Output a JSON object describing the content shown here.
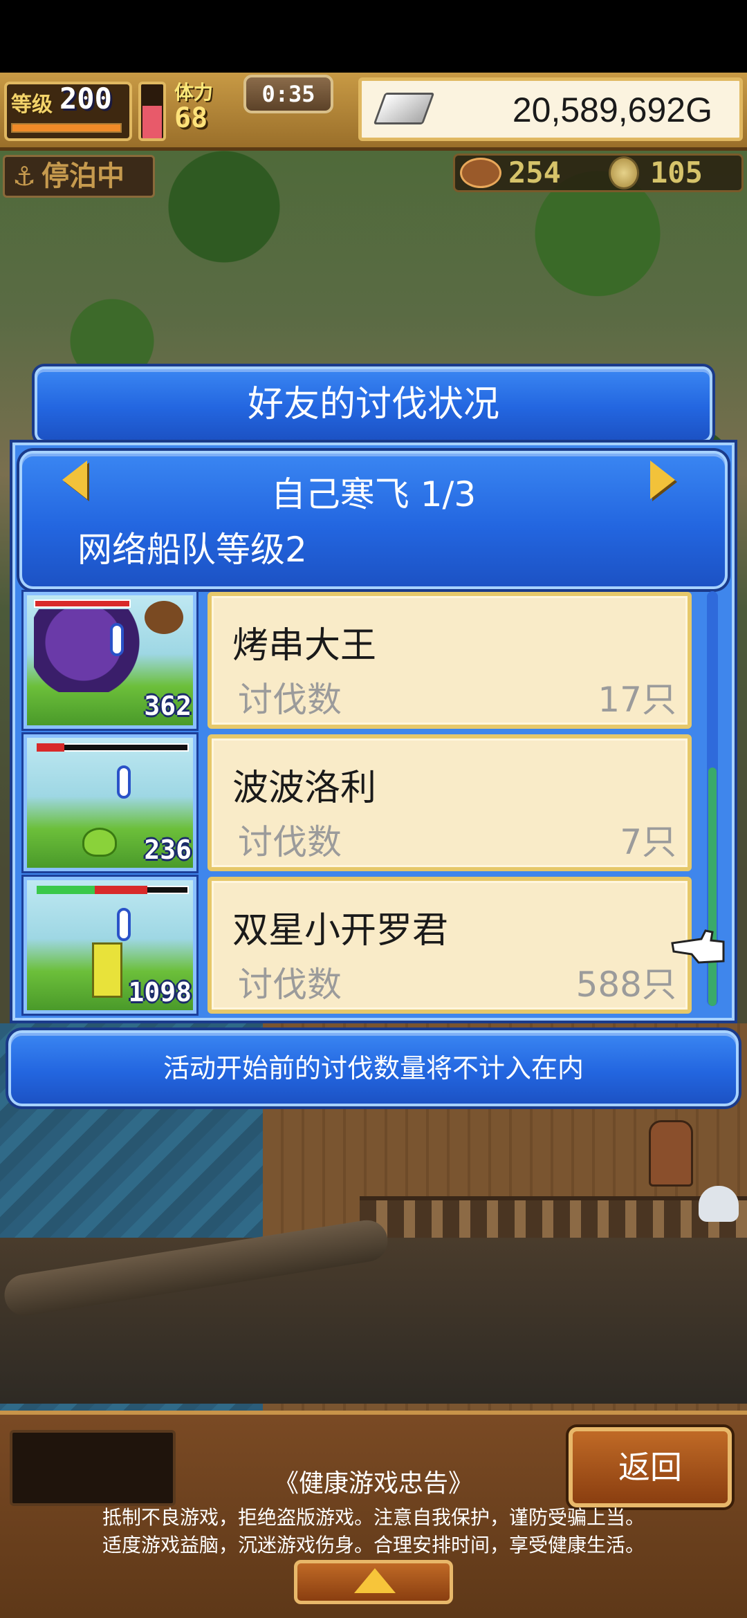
{
  "hud": {
    "level_label": "等级",
    "level_value": "200",
    "stamina_label": "体力",
    "stamina_value": "68",
    "timer": "0:35",
    "gold": "20,589,692G",
    "status": "停泊中",
    "resource_1": "254",
    "resource_2": "105",
    "stamina_fill_fraction": 0.6
  },
  "dialog": {
    "title": "好友的讨伐状况",
    "page_title": "自己寒飞 1/3",
    "fleet_level": "网络船队等级2",
    "notice": "活动开始前的讨伐数量将不计入在内",
    "friends": [
      {
        "name": "烤串大王",
        "kills_label": "讨伐数",
        "kills": "17只",
        "thumb_number": "362",
        "monster": "purple-wizard-icon"
      },
      {
        "name": "波波洛利",
        "kills_label": "讨伐数",
        "kills": "7只",
        "thumb_number": "236",
        "monster": "green-slime-icon"
      },
      {
        "name": "双星小开罗君",
        "kills_label": "讨伐数",
        "kills": "588只",
        "thumb_number": "1098",
        "monster": "yellow-robot-icon"
      }
    ]
  },
  "bottom": {
    "return_label": "返回",
    "health_title": "《健康游戏忠告》",
    "health_line1": "抵制不良游戏，拒绝盗版游戏。注意自我保护，谨防受骗上当。",
    "health_line2": "适度游戏益脑，沉迷游戏伤身。合理安排时间，享受健康生活。"
  },
  "colors": {
    "panel_blue": "#2366e0",
    "card_cream": "#f9ebc8",
    "gold_frame": "#e0b861",
    "arrow_yellow": "#f2c23a"
  }
}
